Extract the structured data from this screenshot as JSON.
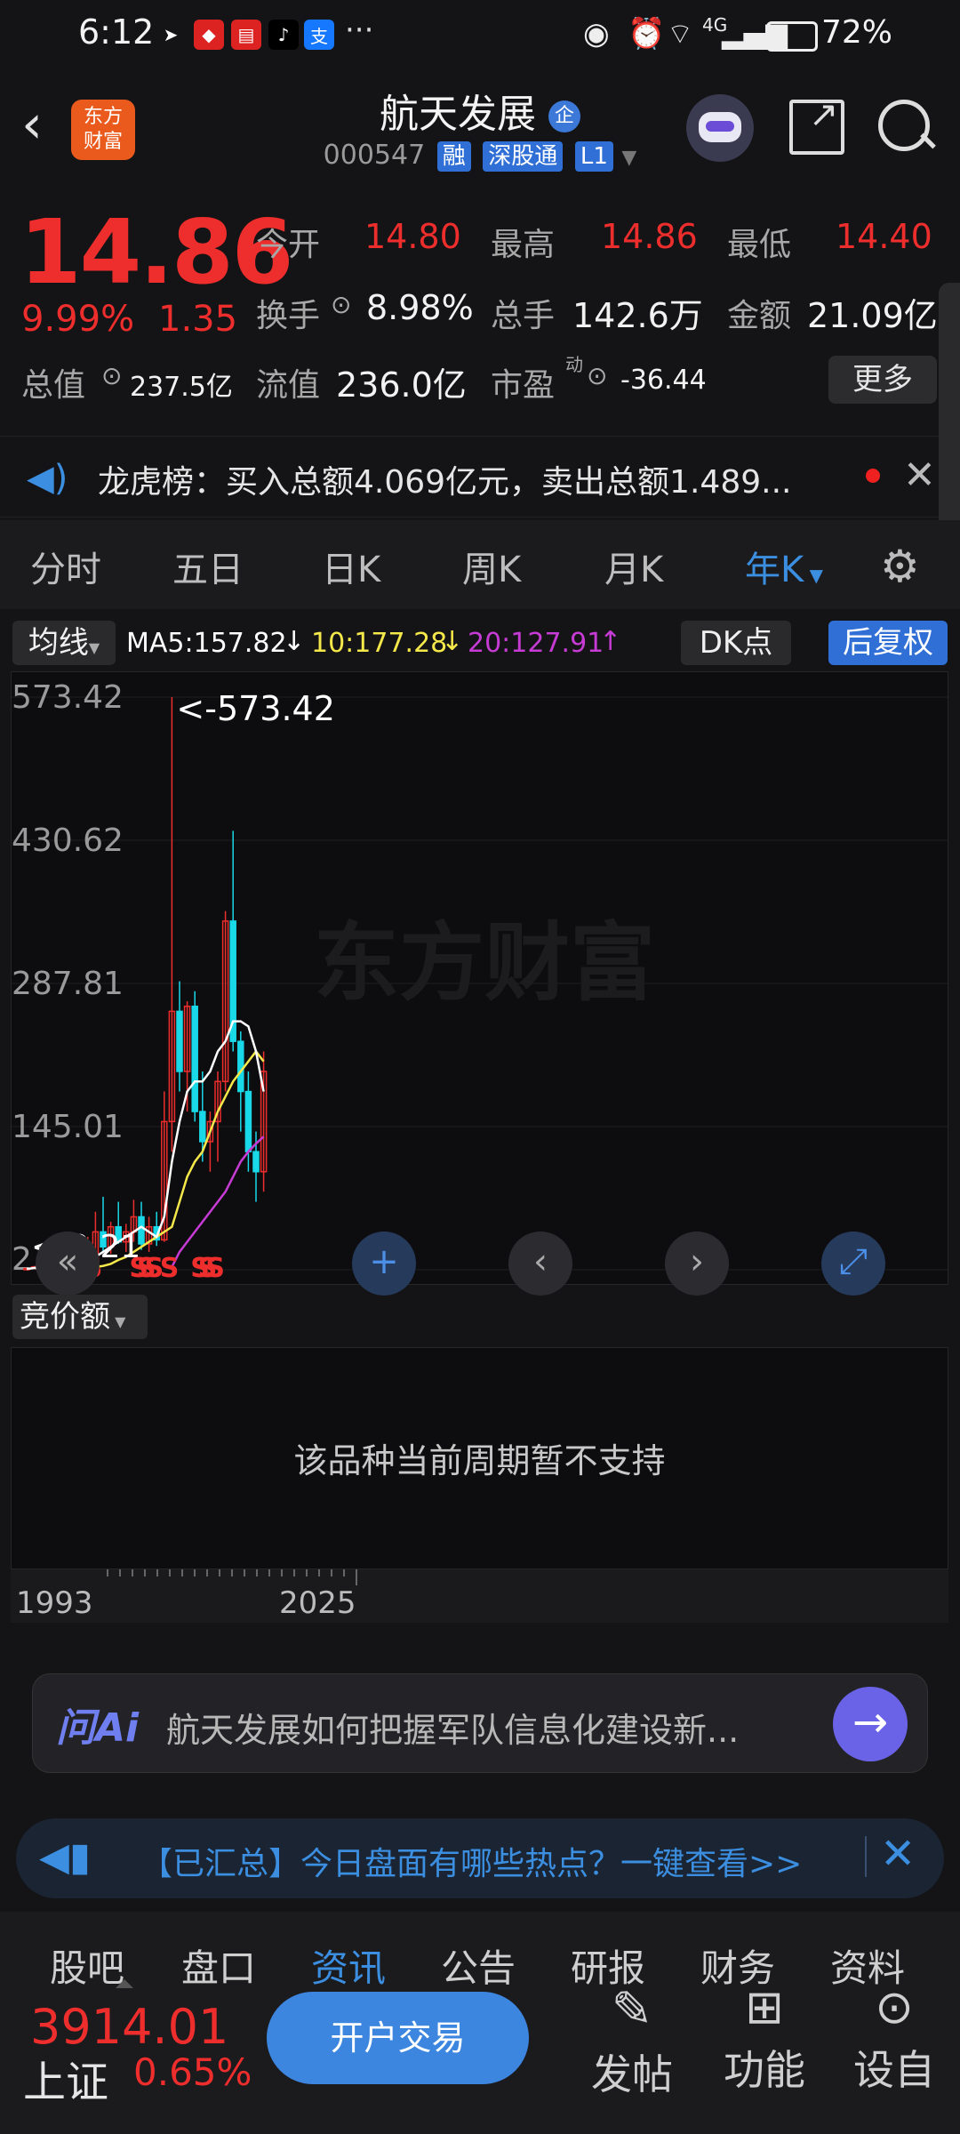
{
  "status_bar": {
    "time": "6:12",
    "battery": "72%",
    "network": "4G"
  },
  "header": {
    "logo_text": "东方\n财富",
    "stock_name": "航天发展",
    "badge": "企",
    "code": "000547",
    "tags": [
      "融",
      "深股通",
      "L1"
    ]
  },
  "quote": {
    "price": "14.86",
    "change_pct": "9.99%",
    "change": "1.35",
    "rows": [
      [
        {
          "label": "今开",
          "value": "14.80",
          "color": "red"
        },
        {
          "label": "最高",
          "value": "14.86",
          "color": "red"
        },
        {
          "label": "最低",
          "value": "14.40",
          "color": "red"
        }
      ],
      [
        {
          "label": "换手",
          "value": "8.98%",
          "color": "white"
        },
        {
          "label": "总手",
          "value": "142.6万",
          "color": "white"
        },
        {
          "label": "金额",
          "value": "21.09亿",
          "color": "white"
        }
      ],
      [
        {
          "label": "总值",
          "value": "237.5亿",
          "color": "white"
        },
        {
          "label": "流值",
          "value": "236.0亿",
          "color": "white"
        },
        {
          "label": "市盈",
          "value": "-36.44",
          "color": "white",
          "superscript": "动"
        }
      ]
    ],
    "more_label": "更多"
  },
  "notice": {
    "text": "龙虎榜：买入总额4.069亿元，卖出总额1.489..."
  },
  "period_tabs": [
    "分时",
    "五日",
    "日K",
    "周K",
    "月K",
    "年K"
  ],
  "active_period": "年K",
  "indicator": {
    "ma_button": "均线",
    "ma5": "MA5:157.82",
    "ma10": "10:177.28",
    "ma20": "20:127.91",
    "dk_button": "DK点",
    "adjust_button": "后复权",
    "colors": {
      "ma5": "#ffffff",
      "ma10": "#f5e84a",
      "ma20": "#c63bd4"
    }
  },
  "chart_data": {
    "type": "candlestick",
    "y_ticks": [
      "573.42",
      "430.62",
      "287.81",
      "145.01",
      "2.21"
    ],
    "ylim": [
      2.21,
      573.42
    ],
    "max_marker": "<-573.42",
    "min_marker": "<-2.21",
    "signal_label": "S",
    "x_ticks": [
      "1993",
      "2025"
    ],
    "watermark": "东方财富",
    "candles": [
      {
        "o": 3,
        "h": 4,
        "l": 2.21,
        "c": 3.5
      },
      {
        "o": 3.5,
        "h": 6,
        "l": 3,
        "c": 5
      },
      {
        "o": 5,
        "h": 9,
        "l": 4,
        "c": 4.5
      },
      {
        "o": 4.5,
        "h": 7,
        "l": 3.5,
        "c": 6
      },
      {
        "o": 6,
        "h": 10,
        "l": 5,
        "c": 5.5
      },
      {
        "o": 5.5,
        "h": 8,
        "l": 4,
        "c": 7
      },
      {
        "o": 7,
        "h": 12,
        "l": 6,
        "c": 8
      },
      {
        "o": 8,
        "h": 20,
        "l": 7,
        "c": 10
      },
      {
        "o": 10,
        "h": 35,
        "l": 9,
        "c": 14
      },
      {
        "o": 14,
        "h": 60,
        "l": 12,
        "c": 40
      },
      {
        "o": 40,
        "h": 75,
        "l": 20,
        "c": 25
      },
      {
        "o": 25,
        "h": 50,
        "l": 18,
        "c": 45
      },
      {
        "o": 45,
        "h": 70,
        "l": 28,
        "c": 30
      },
      {
        "o": 30,
        "h": 48,
        "l": 20,
        "c": 40
      },
      {
        "o": 40,
        "h": 72,
        "l": 30,
        "c": 55
      },
      {
        "o": 55,
        "h": 70,
        "l": 22,
        "c": 28
      },
      {
        "o": 28,
        "h": 55,
        "l": 20,
        "c": 45
      },
      {
        "o": 45,
        "h": 60,
        "l": 26,
        "c": 32
      },
      {
        "o": 32,
        "h": 180,
        "l": 30,
        "c": 150
      },
      {
        "o": 150,
        "h": 573.42,
        "l": 120,
        "c": 260
      },
      {
        "o": 260,
        "h": 290,
        "l": 180,
        "c": 200
      },
      {
        "o": 200,
        "h": 270,
        "l": 160,
        "c": 265
      },
      {
        "o": 265,
        "h": 280,
        "l": 150,
        "c": 160
      },
      {
        "o": 160,
        "h": 200,
        "l": 110,
        "c": 130
      },
      {
        "o": 130,
        "h": 160,
        "l": 100,
        "c": 150
      },
      {
        "o": 150,
        "h": 200,
        "l": 110,
        "c": 190
      },
      {
        "o": 190,
        "h": 360,
        "l": 180,
        "c": 350
      },
      {
        "o": 350,
        "h": 440,
        "l": 220,
        "c": 230
      },
      {
        "o": 230,
        "h": 240,
        "l": 140,
        "c": 180
      },
      {
        "o": 180,
        "h": 200,
        "l": 100,
        "c": 120
      },
      {
        "o": 120,
        "h": 140,
        "l": 70,
        "c": 100
      },
      {
        "o": 100,
        "h": 220,
        "l": 80,
        "c": 200
      }
    ],
    "ma5": [
      3,
      4,
      4.5,
      5,
      5.5,
      6,
      7,
      8,
      10,
      15,
      20,
      25,
      30,
      35,
      40,
      45,
      40,
      35,
      55,
      110,
      150,
      180,
      190,
      190,
      200,
      220,
      230,
      250,
      250,
      245,
      220,
      180
    ],
    "ma10": [
      null,
      null,
      null,
      null,
      null,
      null,
      null,
      null,
      null,
      5,
      6,
      8,
      12,
      15,
      20,
      25,
      30,
      35,
      40,
      45,
      70,
      95,
      110,
      120,
      140,
      160,
      175,
      190,
      200,
      210,
      220,
      210
    ],
    "ma20": [
      null,
      null,
      null,
      null,
      null,
      null,
      null,
      null,
      null,
      null,
      null,
      null,
      null,
      null,
      null,
      null,
      null,
      null,
      null,
      5,
      20,
      30,
      40,
      50,
      60,
      70,
      80,
      95,
      110,
      120,
      128,
      135
    ]
  },
  "sub_chart": {
    "label": "竞价额",
    "empty_message": "该品种当前周期暂不支持"
  },
  "ai_bar": {
    "logo": "问Ai",
    "placeholder": "航天发展如何把握军队信息化建设新..."
  },
  "hot_bar": {
    "text": "【已汇总】今日盘面有哪些热点？一键查看>>"
  },
  "bottom_tabs": [
    "股吧",
    "盘口",
    "资讯",
    "公告",
    "研报",
    "财务",
    "资料"
  ],
  "active_bottom_tab": "资讯",
  "index": {
    "value": "3914.01",
    "name": "上证",
    "change_pct": "0.65%"
  },
  "actions": {
    "trade": "开户交易",
    "post": "发帖",
    "function": "功能",
    "settings": "设自"
  }
}
